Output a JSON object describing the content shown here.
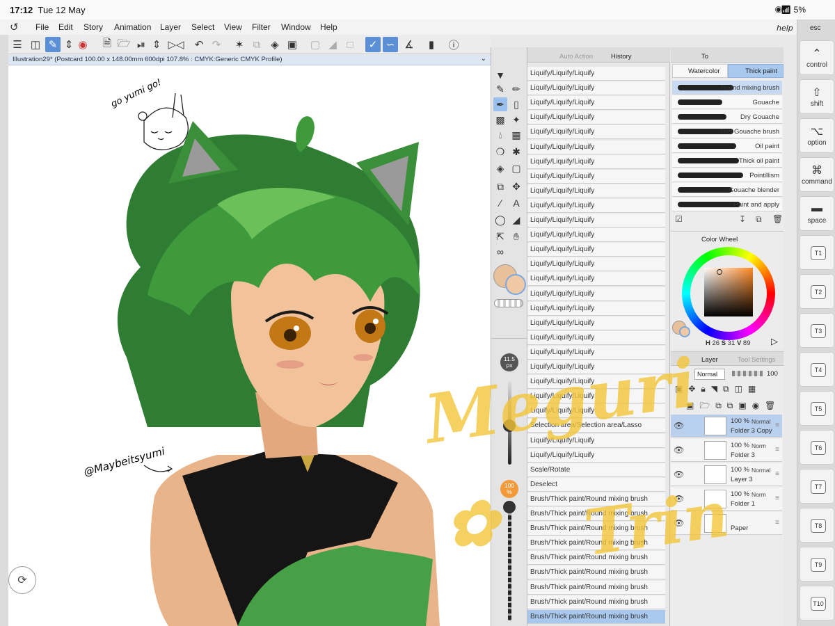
{
  "status": {
    "time": "17:12",
    "date": "Tue 12 May",
    "battery": "5%"
  },
  "menu": [
    "File",
    "Edit",
    "Story",
    "Animation",
    "Layer",
    "Select",
    "View",
    "Filter",
    "Window",
    "Help"
  ],
  "canvas": {
    "tab_title": "Illustration29* (Postcard 100.00 x 148.00mm 600dpi 107.8% : CMYK:Generic CMYK Profile)",
    "sketch_text": "go yumi go!",
    "signature": "@Maybeitsyumi",
    "watermark": [
      "Meguri",
      "Trin"
    ]
  },
  "tool_palette": {
    "brush_size": "11.5",
    "brush_size_unit": "px",
    "opacity": "100",
    "opacity_unit": "%"
  },
  "history": {
    "tabs": [
      "Auto Action",
      "History"
    ],
    "items": [
      "Liquify/Liquify/Liquify",
      "Liquify/Liquify/Liquify",
      "Liquify/Liquify/Liquify",
      "Liquify/Liquify/Liquify",
      "Liquify/Liquify/Liquify",
      "Liquify/Liquify/Liquify",
      "Liquify/Liquify/Liquify",
      "Liquify/Liquify/Liquify",
      "Liquify/Liquify/Liquify",
      "Liquify/Liquify/Liquify",
      "Liquify/Liquify/Liquify",
      "Liquify/Liquify/Liquify",
      "Liquify/Liquify/Liquify",
      "Liquify/Liquify/Liquify",
      "Liquify/Liquify/Liquify",
      "Liquify/Liquify/Liquify",
      "Liquify/Liquify/Liquify",
      "Liquify/Liquify/Liquify",
      "Liquify/Liquify/Liquify",
      "Liquify/Liquify/Liquify",
      "Liquify/Liquify/Liquify",
      "Liquify/Liquify/Liquify",
      "Liquify/Liquify/Liquify",
      "Liquify/Liquify/Liquify",
      "Selection area/Selection area/Lasso",
      "Liquify/Liquify/Liquify",
      "Liquify/Liquify/Liquify",
      "Scale/Rotate",
      "Deselect",
      "Brush/Thick paint/Round mixing brush",
      "Brush/Thick paint/Round mixing brush",
      "Brush/Thick paint/Round mixing brush",
      "Brush/Thick paint/Round mixing brush",
      "Brush/Thick paint/Round mixing brush",
      "Brush/Thick paint/Round mixing brush",
      "Brush/Thick paint/Round mixing brush",
      "Brush/Thick paint/Round mixing brush",
      "Brush/Thick paint/Round mixing brush"
    ]
  },
  "brush_panel": {
    "tab_label": "To",
    "groups": [
      "Watercolor",
      "Thick paint"
    ],
    "brushes": [
      "Round mixing brush",
      "Gouache",
      "Dry Gouache",
      "Thin Gouache brush",
      "Oil paint",
      "Thick oil paint",
      "Pointillism",
      "Gouache blender",
      "Paint and apply"
    ]
  },
  "color_panel": {
    "title": "Color Wheel",
    "h_label": "H",
    "h": "26",
    "s_label": "S",
    "s": "31",
    "v_label": "V",
    "v": "89",
    "main_color": "#e8c09a",
    "sub_color": "#f0c8a4"
  },
  "layers_panel": {
    "tabs": [
      "Layer",
      "Tool Settings"
    ],
    "blend_mode": "Normal",
    "opacity": "100",
    "layers": [
      {
        "pct": "100 %",
        "blend": "Normal",
        "name": "Folder 3 Copy"
      },
      {
        "pct": "100 %",
        "blend": "Norm",
        "name": "Folder 3"
      },
      {
        "pct": "100 %",
        "blend": "Normal",
        "name": "Layer 3"
      },
      {
        "pct": "100 %",
        "blend": "Norm",
        "name": "Folder 1"
      },
      {
        "pct": "",
        "blend": "",
        "name": "Paper"
      }
    ]
  },
  "shortcuts": {
    "help": "help",
    "keys": [
      "esc",
      "control",
      "shift",
      "option",
      "command",
      "space"
    ],
    "tkeys": [
      "T1",
      "T2",
      "T3",
      "T4",
      "T5",
      "T6",
      "T7",
      "T8",
      "T9",
      "T10"
    ]
  },
  "colors": {
    "accent": "#5b8fd6",
    "selection": "#a9c8ee",
    "hair": "#3f9a3b",
    "skin": "#e7b48c",
    "watermark": "#f3c63a"
  }
}
